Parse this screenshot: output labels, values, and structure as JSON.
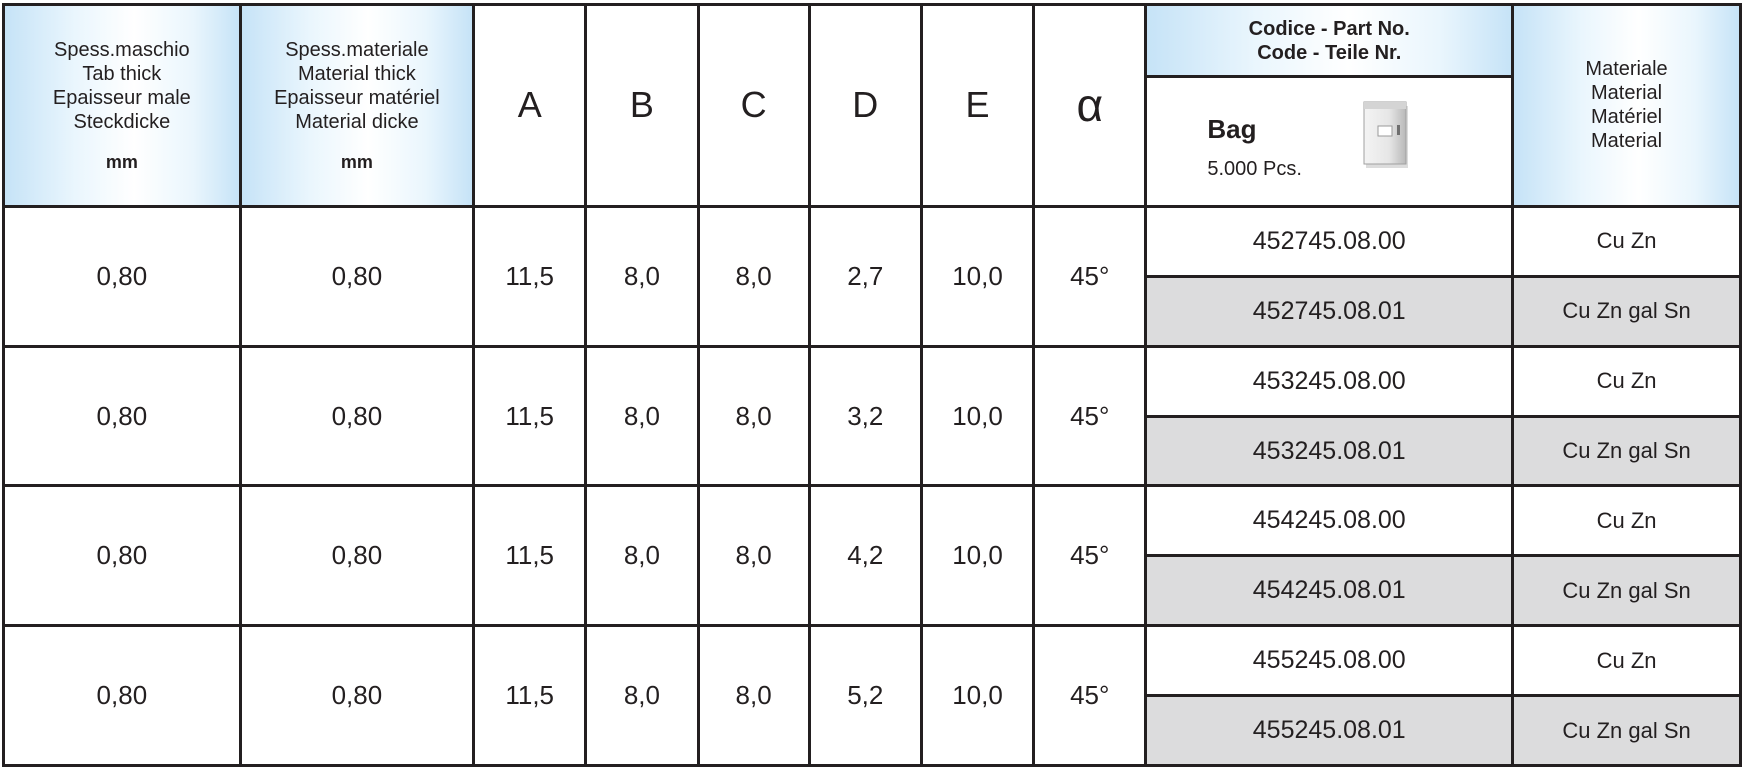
{
  "header": {
    "tab_thick": [
      "Spess.maschio",
      "Tab thick",
      "Epaisseur male",
      "Steckdicke"
    ],
    "tab_thick_unit": "mm",
    "material_thick": [
      "Spess.materiale",
      "Material thick",
      "Epaisseur matériel",
      "Material dicke"
    ],
    "material_thick_unit": "mm",
    "col_a": "A",
    "col_b": "B",
    "col_c": "C",
    "col_d": "D",
    "col_e": "E",
    "col_alpha": "α",
    "code_title": [
      "Codice - Part No.",
      "Code - Teile Nr."
    ],
    "bag_label": "Bag",
    "bag_qty": "5.000 Pcs.",
    "material_title": [
      "Materiale",
      "Material",
      "Matériel",
      "Material"
    ]
  },
  "rows": [
    {
      "tab": "0,80",
      "mat": "0,80",
      "a": "11,5",
      "b": "8,0",
      "c": "8,0",
      "d": "2,7",
      "e": "10,0",
      "alpha": "45°",
      "code1": "452745.08.00",
      "material1": "Cu Zn",
      "code2": "452745.08.01",
      "material2": "Cu Zn gal Sn"
    },
    {
      "tab": "0,80",
      "mat": "0,80",
      "a": "11,5",
      "b": "8,0",
      "c": "8,0",
      "d": "3,2",
      "e": "10,0",
      "alpha": "45°",
      "code1": "453245.08.00",
      "material1": "Cu Zn",
      "code2": "453245.08.01",
      "material2": "Cu Zn gal Sn"
    },
    {
      "tab": "0,80",
      "mat": "0,80",
      "a": "11,5",
      "b": "8,0",
      "c": "8,0",
      "d": "4,2",
      "e": "10,0",
      "alpha": "45°",
      "code1": "454245.08.00",
      "material1": "Cu Zn",
      "code2": "454245.08.01",
      "material2": "Cu Zn gal Sn"
    },
    {
      "tab": "0,80",
      "mat": "0,80",
      "a": "11,5",
      "b": "8,0",
      "c": "8,0",
      "d": "5,2",
      "e": "10,0",
      "alpha": "45°",
      "code1": "455245.08.00",
      "material1": "Cu Zn",
      "code2": "455245.08.01",
      "material2": "Cu Zn gal Sn"
    }
  ],
  "colors": {
    "border": "#231f20",
    "header_blue": "#c6e3f7",
    "alt_row": "#dcdcdd"
  },
  "icons": {
    "bag": "bag-icon"
  }
}
